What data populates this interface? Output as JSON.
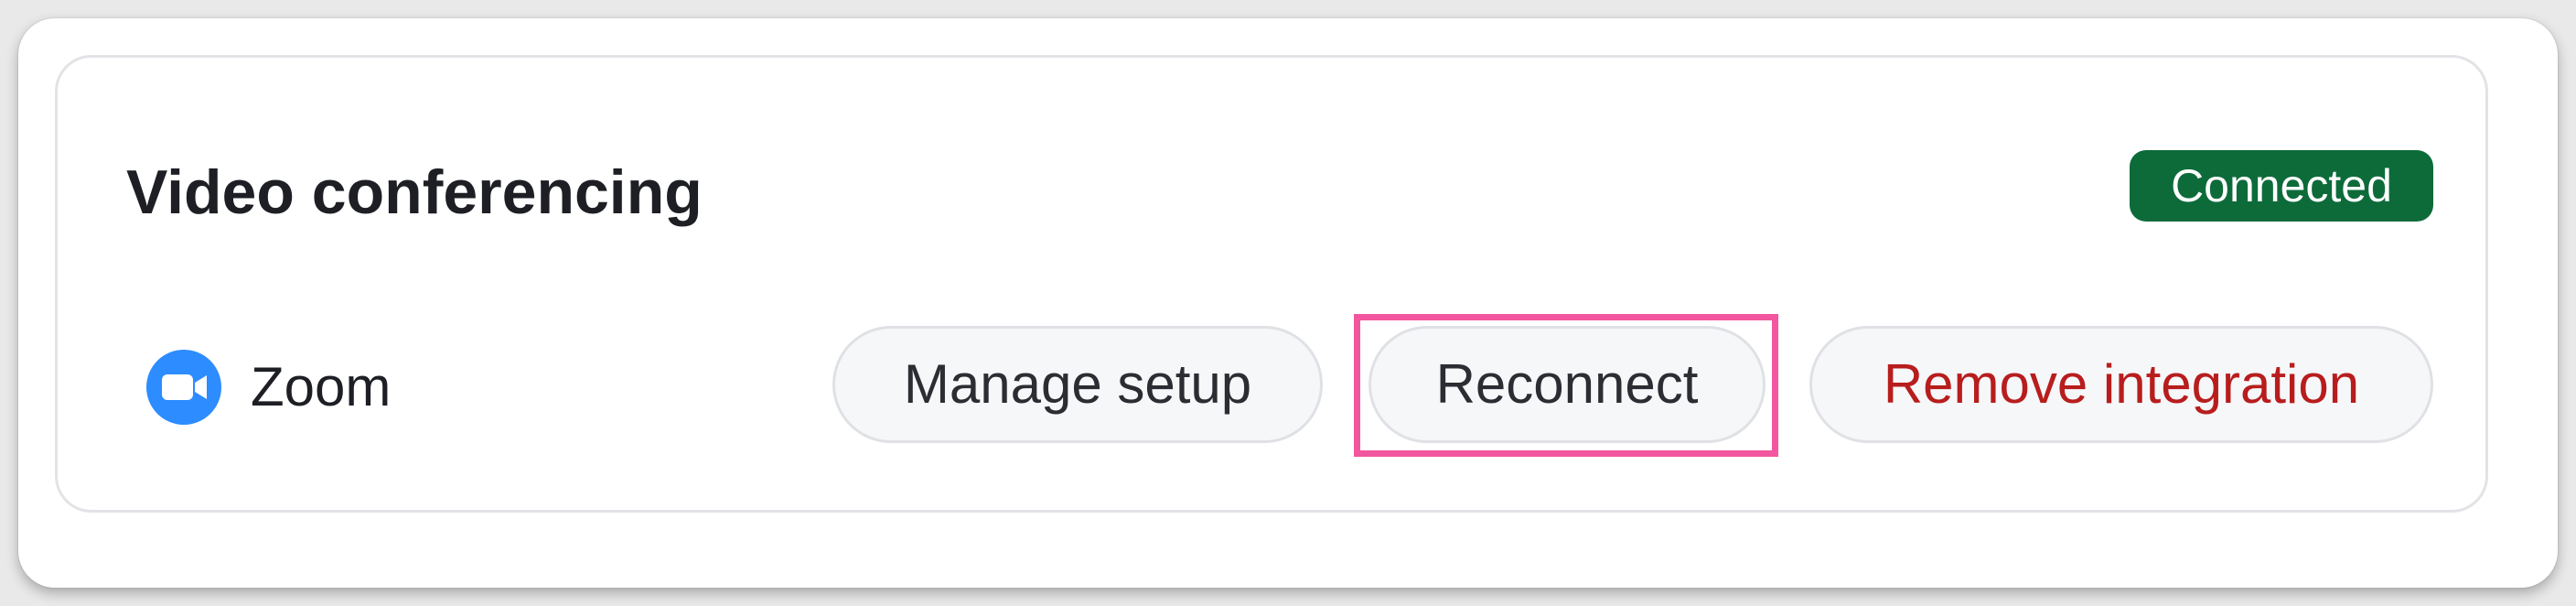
{
  "section": {
    "title": "Video conferencing",
    "status": "Connected"
  },
  "integration": {
    "provider_name": "Zoom",
    "provider_icon": "zoom-camera-icon"
  },
  "actions": {
    "manage_label": "Manage setup",
    "reconnect_label": "Reconnect",
    "remove_label": "Remove integration"
  },
  "colors": {
    "status_badge": "#0d6b3a",
    "provider_icon": "#2d8cff",
    "remove_text": "#b81d1d",
    "highlight": "#f2569f"
  }
}
